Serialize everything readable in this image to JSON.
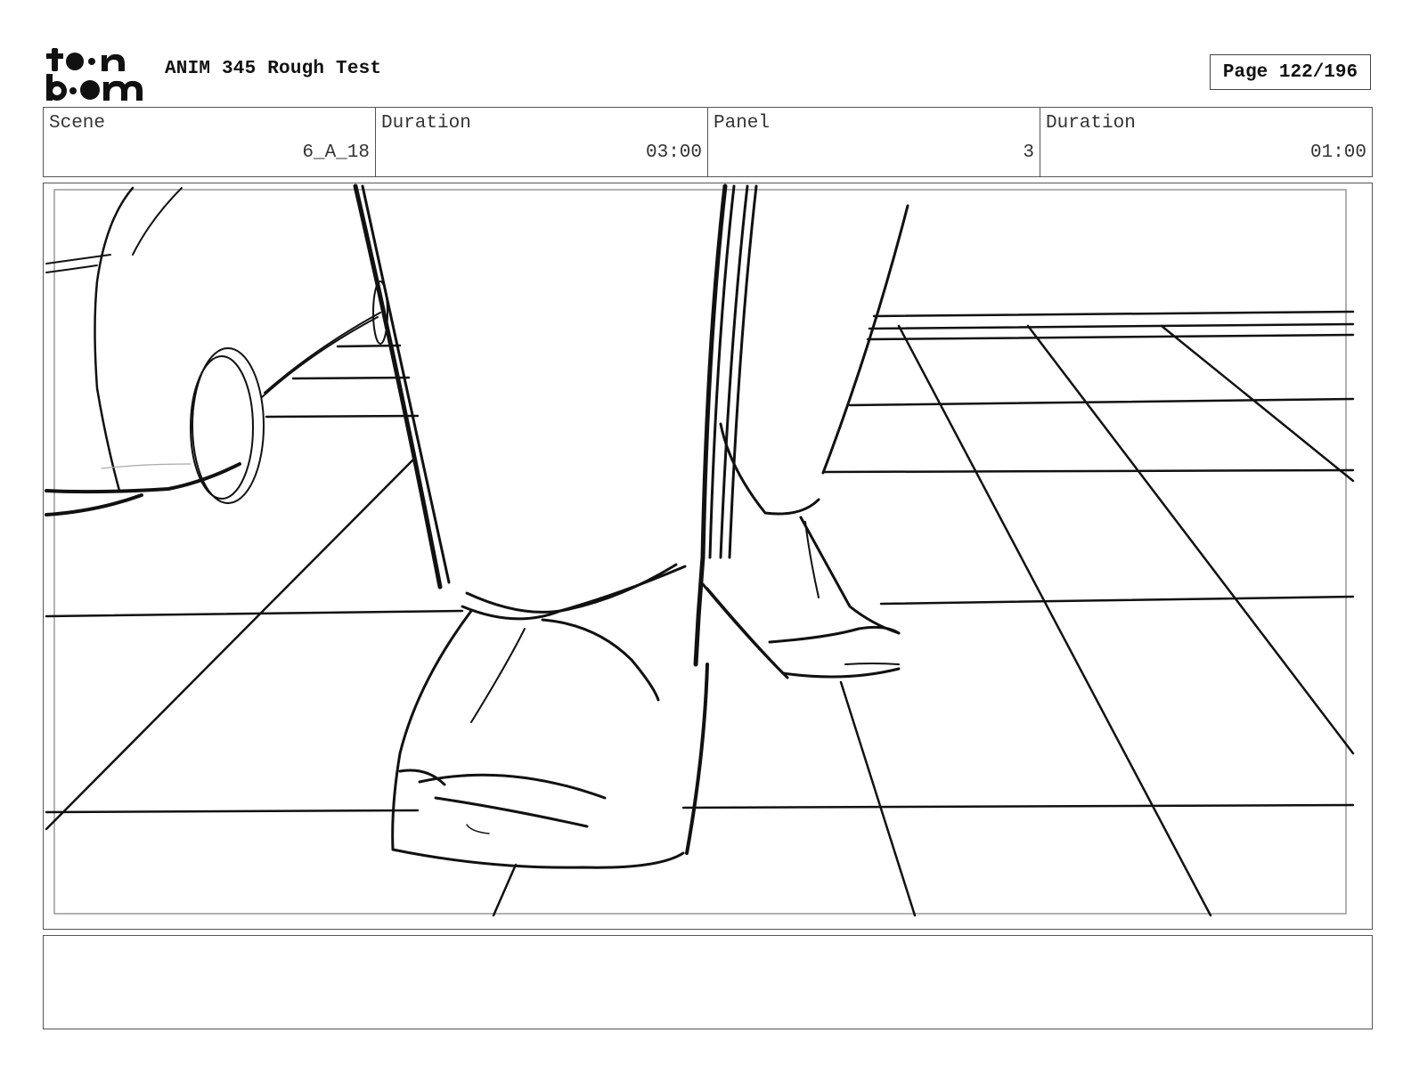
{
  "header": {
    "logo_text": "toon boom",
    "title": "ANIM 345 Rough Test",
    "page_label": "Page 122/196"
  },
  "info": {
    "scene_label": "Scene",
    "scene_value": "6_A_18",
    "scene_duration_label": "Duration",
    "scene_duration_value": "03:00",
    "panel_label": "Panel",
    "panel_value": "3",
    "panel_duration_label": "Duration",
    "panel_duration_value": "01:00"
  },
  "notes": {
    "text": ""
  }
}
